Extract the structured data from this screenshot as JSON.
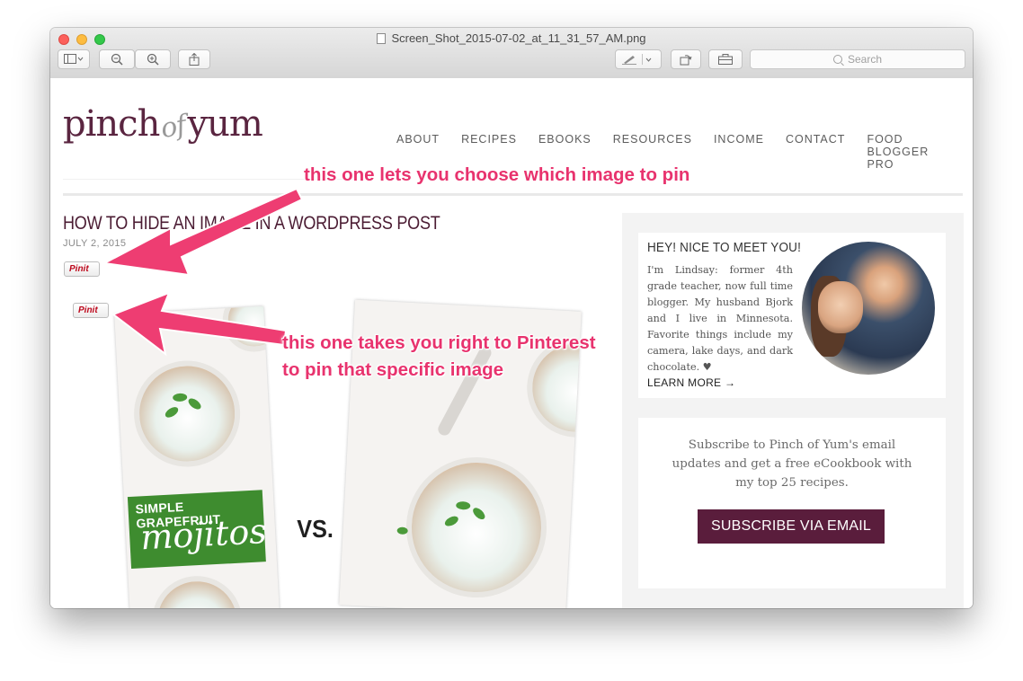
{
  "window": {
    "filename": "Screen_Shot_2015-07-02_at_11_31_57_AM.png",
    "search_placeholder": "Search"
  },
  "site": {
    "logo_left": "pinch",
    "logo_mid": "of",
    "logo_right": "yum",
    "nav": [
      "ABOUT",
      "RECIPES",
      "EBOOKS",
      "RESOURCES",
      "INCOME",
      "CONTACT",
      "FOOD BLOGGER PRO"
    ]
  },
  "post": {
    "title": "HOW TO HIDE AN IMAGE IN A WORDPRESS POST",
    "date": "JULY 2, 2015",
    "pin_label": "Pinit",
    "image_label_small": "SIMPLE GRAPEFRUIT",
    "image_label_big": "mojitos",
    "vs": "VS."
  },
  "sidebar": {
    "heading": "HEY! NICE TO MEET YOU!",
    "bio": "I'm Lindsay: former 4th grade teacher, now full time blogger. My husband Bjork and I live in Minnesota. Favorite things include my camera, lake days, and dark chocolate. ♥",
    "learn_more": "LEARN MORE →",
    "subscribe_text": "Subscribe to Pinch of Yum's email updates and get a free eCookbook with my top 25 recipes.",
    "subscribe_button": "SUBSCRIBE VIA EMAIL"
  },
  "annotations": {
    "top": "this one lets you choose which image to pin",
    "bottom_line1": "this one takes you right to Pinterest",
    "bottom_line2": "to pin that specific image"
  },
  "colors": {
    "brand": "#5a1d3c",
    "annotation": "#e8336e",
    "pin_red": "#bd081c"
  }
}
